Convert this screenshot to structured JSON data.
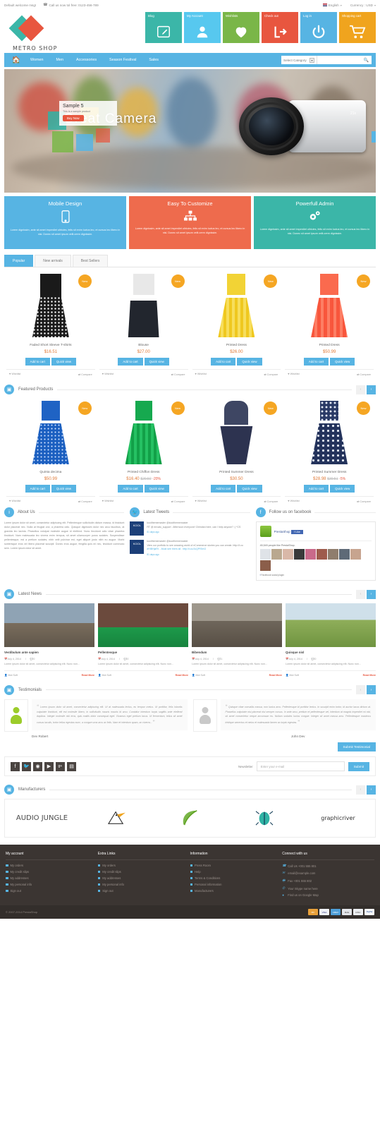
{
  "topbar": {
    "welcome": "Default welcome msg!",
    "phone_icon": "phone-icon",
    "phone": "Call us now tol free: 0123-456-789",
    "language": "English",
    "currency": "Currency : USD"
  },
  "header": {
    "logo_text": "METRO SHOP",
    "tiles": [
      {
        "label": "Blog",
        "icon": "pencil-edit-icon",
        "color": "#3bb6a8"
      },
      {
        "label": "My Account",
        "icon": "user-icon",
        "color": "#57c8ef"
      },
      {
        "label": "Wishlists",
        "icon": "heart-icon",
        "color": "#7ab648"
      },
      {
        "label": "Check out",
        "icon": "signout-icon",
        "color": "#e8563f"
      },
      {
        "label": "Log in",
        "icon": "power-icon",
        "color": "#57b4e3"
      },
      {
        "label": "Shopping cart",
        "icon": "cart-icon",
        "color": "#f0a41e"
      }
    ]
  },
  "nav": {
    "home_icon": "home-icon",
    "items": [
      "Women",
      "Men",
      "Accessories",
      "Season Festival",
      "Sales"
    ],
    "category_select": "Select Category",
    "search_placeholder": "",
    "search_icon": "search-icon"
  },
  "slider": {
    "caption_title": "Sample 5",
    "caption_sub": "This is a sample product",
    "caption_button": "Buy Now",
    "headline": "Great Camera",
    "zoom_label": "21x",
    "next_icon": "chevron-right-icon"
  },
  "promos": [
    {
      "title": "Mobile Design",
      "icon": "mobile-phone-icon",
      "color": "#57b4e3",
      "text": "Lorem dignissim, ante sit amet imperdiet ultricies, felis sit enim luctus leo, et cursus leo libero in nisi. Donec sit amet ipsum velit.orem dignissim."
    },
    {
      "title": "Easy To Customize",
      "icon": "sitemap-icon",
      "color": "#ee6b4d",
      "text": "Lorem dignissim, ante sit amet imperdiet ultricies, felis sit enim luctus leo, et cursus leo libero in nisi. Donec sit amet ipsum velit.orem dignissim."
    },
    {
      "title": "Powerfull Admin",
      "icon": "gears-icon",
      "color": "#3bb6a8",
      "text": "Lorem dignissim, ante sit amet imperdiet ultricies, felis sit enim luctus leo, et cursus leo libero in nisi. Donec sit amet ipsum velit.orem dignissim."
    }
  ],
  "tabs": [
    {
      "label": "Popular",
      "active": true
    },
    {
      "label": "New arrivals",
      "active": false
    },
    {
      "label": "Best Sellers",
      "active": false
    }
  ],
  "products_popular": [
    {
      "name": "Faded Short Sleeve T-shirts",
      "price": "$16.51",
      "badge": "New",
      "badge_type": "new",
      "add": "Add to cart",
      "quick": "Quick view",
      "wish": "Wishlist",
      "comp": "Compare",
      "top_color": "#f2f2f2",
      "skirt_color": "#1a1a1a",
      "pattern": "dots"
    },
    {
      "name": "Blouse",
      "price": "$27.00",
      "badge": "New",
      "badge_type": "new",
      "add": "Add to cart",
      "quick": "Quick view",
      "wish": "Wishlist",
      "comp": "Compare",
      "top_color": "#e8e8e8",
      "skirt_color": "#22262e",
      "pattern": "none"
    },
    {
      "name": "Printed Dress",
      "price": "$26.00",
      "badge": "New",
      "badge_type": "new",
      "add": "Add to cart",
      "quick": "Quick view",
      "wish": "Wishlist",
      "comp": "Compare",
      "top_color": "#f2d335",
      "skirt_color": "#efc81f",
      "pattern": "none"
    },
    {
      "name": "Printed Dress",
      "price": "$50.99",
      "badge": "New",
      "badge_type": "new",
      "add": "Add to cart",
      "quick": "Quick view",
      "wish": "Wishlist",
      "comp": "Compare",
      "top_color": "#fa6a4e",
      "skirt_color": "#f8563c",
      "pattern": "none"
    }
  ],
  "featured": {
    "title": "Featured Products",
    "icon": "box-icon",
    "prev_icon": "chevron-left-icon",
    "next_icon": "chevron-right-icon",
    "products": [
      {
        "name": "Quinta decima",
        "price": "$50.99",
        "old": "",
        "disc": "",
        "badge": "New",
        "badge_type": "new",
        "add": "Add to cart",
        "quick": "Quick view",
        "wish": "Wishlist",
        "comp": "Compare",
        "top_color": "#1f63c4",
        "skirt_color": "#1b5fc0",
        "pattern": "dots"
      },
      {
        "name": "Printed Chiffon Dress",
        "price": "$16.40",
        "old": "$20.50",
        "disc": "-20%",
        "badge": "New",
        "badge_type": "new",
        "add": "Add to cart",
        "quick": "Quick view",
        "wish": "Wishlist",
        "comp": "Compare",
        "top_color": "#16a94f",
        "skirt_color": "#12a048",
        "pattern": "none"
      },
      {
        "name": "Printed Summer Dress",
        "price": "$30.50",
        "old": "",
        "disc": "",
        "badge": "New",
        "badge_type": "new",
        "add": "Add to cart",
        "quick": "Quick view",
        "wish": "Wishlist",
        "comp": "Compare",
        "top_color": "#3e4663",
        "skirt_color": "#2d3350",
        "pattern": "none"
      },
      {
        "name": "Printed Summer Dress",
        "price": "$28.98",
        "old": "$30.51",
        "disc": "-5%",
        "badge": "New",
        "badge_type": "new",
        "add": "Add to cart",
        "quick": "Quick view",
        "wish": "Wishlist",
        "comp": "Compare",
        "top_color": "#2a3a66",
        "skirt_color": "#24335c",
        "pattern": "floral"
      }
    ]
  },
  "about": {
    "title": "About Us",
    "icon": "info-icon",
    "text": "Lorem ipsum dolor sit amet, consectetur adipiscing elit. Pellentesque sollicitudin dictum massa, id tincidunt dolor placerat nec. Nulla at feugiat orci, a pharetra odio. Quisque dignissim dolor nec arcu faucibus, at gravida leo lacinia. Phasellus volutpat molestie augue id eleifend. Nunc tincidunt odio vitae pharetra tincidunt. Nam malesuada leo viverra enim tempus, sit amet ullamcorper purus sodales. Suspendisse pellentesque, est a pretium sodales, nibh velit pulvinar est, eget aliquet justo nibh eu augue. Morbi scelerisque eros vel libero placerat suscipit. Donec eros augue, fringilla quis mi nec, tincidunt commodo sem. Lorem ipsum dolor sit amet."
  },
  "tweets": {
    "title": "Latest Tweets",
    "icon": "twitter-icon",
    "avatar_label": "KOOL",
    "items": [
      {
        "user": "koolthememaster",
        "handle": "@koolthememaster",
        "text": "RT @ envato_support : Afternoon everyone! Christian here, can I help anyone? :) *CS",
        "link": "",
        "ago": "81 days ago"
      },
      {
        "user": "koolthememaster",
        "handle": "@koolthememaster",
        "text": "View our portfolio to see amazing world of eCommerce stories you can create. http://t.co",
        "link": "#HIBHjaRt ...Must see them all : http://t.co/JuQPfSmG",
        "ago": "81 days ago"
      }
    ]
  },
  "facebook": {
    "title": "Follow us on facebook",
    "icon": "facebook-icon",
    "page_name": "PrestaShop",
    "like_label": "Like",
    "likes_text": "45,549 people like PrestaShop.",
    "footer": "Facebook social plugin"
  },
  "news": {
    "title": "Latest News",
    "icon": "box-icon",
    "prev_icon": "chevron-left-icon",
    "next_icon": "chevron-right-icon",
    "items": [
      {
        "title": "Vestibulum ante sapien",
        "date": "July 4, 2014",
        "comments": "0",
        "text": "Lorem ipsum dolor sit amet, consectetur adipiscing elit. Nunc non...",
        "author": "Mot Soft",
        "read_more": "Read More",
        "img_top": "#8fa3b4",
        "img_bottom": "#7a6d5d"
      },
      {
        "title": "Pellentesque",
        "date": "July 4, 2014",
        "comments": "0",
        "text": "Lorem ipsum dolor sit amet, consectetur adipiscing elit. Nunc non...",
        "author": "Mot Soft",
        "read_more": "Read More",
        "img_top": "#6b4a3d",
        "img_bottom": "#1d9a4a"
      },
      {
        "title": "Bibendum",
        "date": "July 4, 2014",
        "comments": "1",
        "text": "Lorem ipsum dolor sit amet, consectetur adipiscing elit. Nunc non...",
        "author": "Mot Soft",
        "read_more": "Read More",
        "img_top": "#9e978c",
        "img_bottom": "#6f665b"
      },
      {
        "title": "Quisque nisl",
        "date": "July 4, 2014",
        "comments": "0",
        "text": "Lorem ipsum dolor sit amet, consectetur adipiscing elit. Nunc non...",
        "author": "Mot Soft",
        "read_more": "Read More",
        "img_top": "#8fae5a",
        "img_bottom": "#6f9440"
      }
    ],
    "date_icon": "calendar-icon",
    "comment_icon": "comment-icon",
    "author_icon": "user-icon"
  },
  "testimonials": {
    "title": "Testimonials",
    "icon": "box-icon",
    "prev_icon": "chevron-left-icon",
    "next_icon": "chevron-right-icon",
    "submit_label": "Submit Testimonial",
    "items": [
      {
        "text": "Lorem ipsum dolor sit amet, consectetur adipiscing elit. Ut at malesuada lectus, eu tempor metus. Ut porttitor, felis lobortis vulputate tincidunt, elit est molestie libero, in sollicitudin mauris mauris id arcu. Curabitur interdum turpis sagittis ante eleifend dapibus. Integer molestie nisl eros, quis mattis dolor consequat eget. Vivamus eget pretium lacus. Ut fermentum, tellus sit amet cursus iaculis, tortor tellus egestas nunc, a congue urna arcu ac felis. Nam et interdum quam, ac viverra...",
        "name": "Dev Robert",
        "avatar_color": "#9ccc2a"
      },
      {
        "text": "Quisque vitae convallis massa, non luctus arcu. Pellentesque id porttitor lectus. In suscipit enim tortor, id auctor lacus dictum at. Phasellus vulputate nisi placerat nisi semper cursus. In ante arcu, pretium et pellentesque vel, interdum at magnis imperdiet mi nisl, sit amet consectetur neque accumsan eu. Nullam sodales luctus congue. Integer sit amet massa arcu. Pellentesque maximus tristique senectus et netus et malesuada famen ac turpis egestas.",
        "name": "John Dev",
        "avatar_color": "#bdbdbd"
      }
    ]
  },
  "social": {
    "icons": [
      "facebook-icon",
      "twitter-icon",
      "rss-icon",
      "youtube-icon",
      "google-plus-icon",
      "instagram-icon"
    ],
    "glyphs": [
      "f",
      "✉",
      "◔",
      "▶",
      "g+",
      "▣"
    ]
  },
  "newsletter": {
    "label": "Newsletter",
    "placeholder": "Enter your e-mail",
    "submit": "Submit"
  },
  "manufacturers": {
    "title": "Manufacturers",
    "icon": "box-icon",
    "prev_icon": "chevron-left-icon",
    "next_icon": "chevron-right-icon",
    "logos": [
      "AUDIO JUNGLE",
      "eagle-icon",
      "leaf-icon",
      "bug-icon",
      "graphicriver"
    ]
  },
  "footer": {
    "columns": [
      {
        "title": "My account",
        "items": [
          "My orders",
          "My credit slips",
          "My addresses",
          "My personal info",
          "Sign out"
        ]
      },
      {
        "title": "Extra Links",
        "items": [
          "My orders",
          "My credit slips",
          "My addresses",
          "My personal info",
          "Sign out"
        ]
      },
      {
        "title": "Information",
        "items": [
          "Press Room",
          "Help",
          "Terms & Conditions",
          "Personal information",
          "Manufacturers"
        ]
      }
    ],
    "connect": {
      "title": "Connect with us",
      "items": [
        {
          "icon": "headset-icon",
          "label": "Call Us +001 555 801"
        },
        {
          "icon": "envelope-icon",
          "label": "email@example.com"
        },
        {
          "icon": "fax-icon",
          "label": "Fax +001 555 802"
        },
        {
          "icon": "skype-icon",
          "label": "Your Skype name here"
        },
        {
          "icon": "map-marker-icon",
          "label": "Find us on Google Map"
        }
      ]
    },
    "copyright": "© 2007-2014 PrestaShop",
    "cards": [
      {
        "name": "mastercard",
        "color": "#e9a13b",
        "text": "MC"
      },
      {
        "name": "visa",
        "color": "#f0f3f7",
        "text": "VISA"
      },
      {
        "name": "amex",
        "color": "#4f9fd8",
        "text": "AMEX"
      },
      {
        "name": "maestro",
        "color": "#e4e6ea",
        "text": "MAE"
      },
      {
        "name": "discover",
        "color": "#eceef1",
        "text": "DISC"
      },
      {
        "name": "paypal",
        "color": "#f7f8fa",
        "text": "PayPal"
      }
    ]
  }
}
